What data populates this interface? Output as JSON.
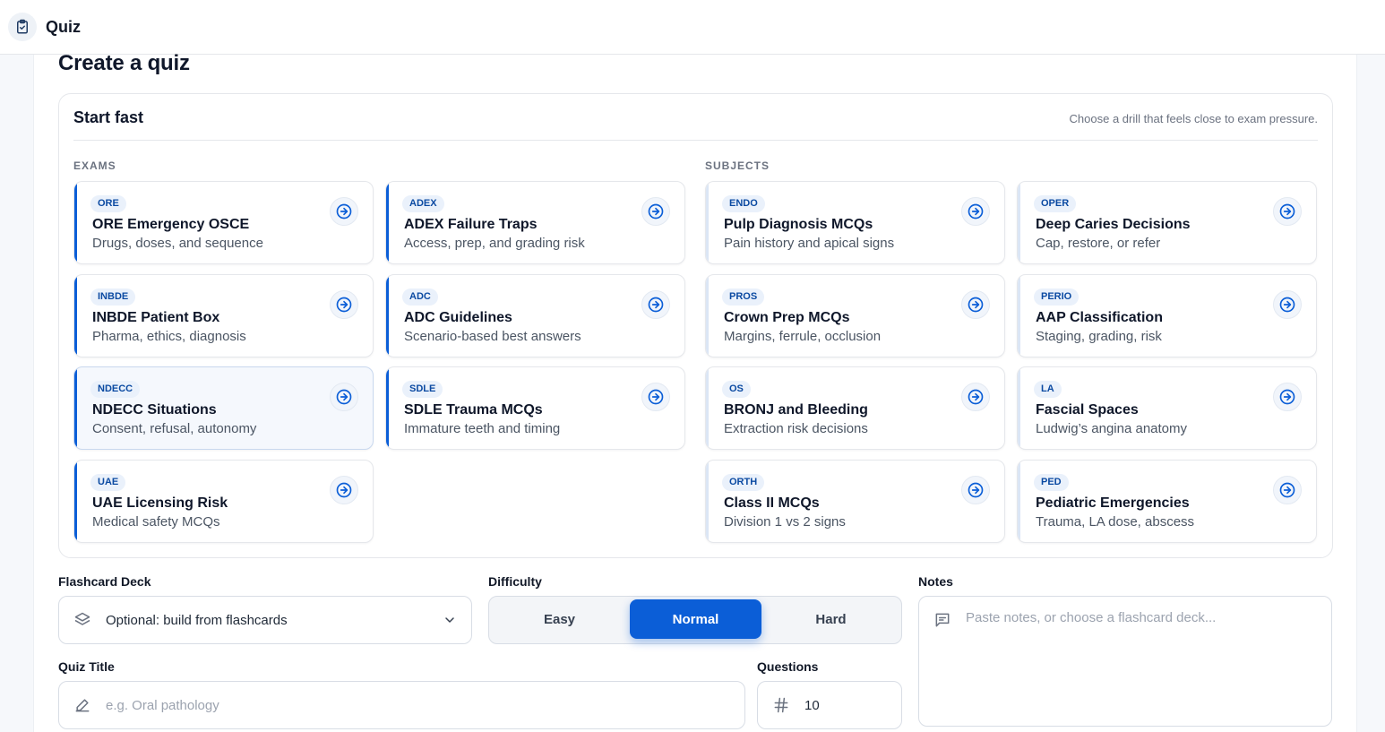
{
  "header": {
    "app_title": "Quiz",
    "icon": "clipboard-check-icon"
  },
  "page": {
    "title": "Create a quiz"
  },
  "start_fast": {
    "title": "Start fast",
    "hint": "Choose a drill that feels close to exam pressure.",
    "exams_label": "EXAMS",
    "subjects_label": "SUBJECTS",
    "exams": [
      {
        "tag": "ORE",
        "title": "ORE Emergency OSCE",
        "subtitle": "Drugs, doses, and sequence"
      },
      {
        "tag": "ADEX",
        "title": "ADEX Failure Traps",
        "subtitle": "Access, prep, and grading risk"
      },
      {
        "tag": "INBDE",
        "title": "INBDE Patient Box",
        "subtitle": "Pharma, ethics, diagnosis"
      },
      {
        "tag": "ADC",
        "title": "ADC Guidelines",
        "subtitle": "Scenario-based best answers"
      },
      {
        "tag": "NDECC",
        "title": "NDECC Situations",
        "subtitle": "Consent, refusal, autonomy"
      },
      {
        "tag": "SDLE",
        "title": "SDLE Trauma MCQs",
        "subtitle": "Immature teeth and timing"
      },
      {
        "tag": "UAE",
        "title": "UAE Licensing Risk",
        "subtitle": "Medical safety MCQs"
      }
    ],
    "subjects": [
      {
        "tag": "ENDO",
        "title": "Pulp Diagnosis MCQs",
        "subtitle": "Pain history and apical signs"
      },
      {
        "tag": "OPER",
        "title": "Deep Caries Decisions",
        "subtitle": "Cap, restore, or refer"
      },
      {
        "tag": "PROS",
        "title": "Crown Prep MCQs",
        "subtitle": "Margins, ferrule, occlusion"
      },
      {
        "tag": "PERIO",
        "title": "AAP Classification",
        "subtitle": "Staging, grading, risk"
      },
      {
        "tag": "OS",
        "title": "BRONJ and Bleeding",
        "subtitle": "Extraction risk decisions"
      },
      {
        "tag": "LA",
        "title": "Fascial Spaces",
        "subtitle": "Ludwig’s angina anatomy"
      },
      {
        "tag": "ORTH",
        "title": "Class II MCQs",
        "subtitle": "Division 1 vs 2 signs"
      },
      {
        "tag": "PED",
        "title": "Pediatric Emergencies",
        "subtitle": "Trauma, LA dose, abscess"
      }
    ]
  },
  "form": {
    "deck_label": "Flashcard Deck",
    "deck_value": "Optional: build from flashcards",
    "difficulty_label": "Difficulty",
    "difficulty_options": [
      "Easy",
      "Normal",
      "Hard"
    ],
    "difficulty_selected": "Normal",
    "notes_label": "Notes",
    "notes_placeholder": "Paste notes, or choose a flashcard deck...",
    "title_label": "Quiz Title",
    "title_placeholder": "e.g. Oral pathology",
    "questions_label": "Questions",
    "questions_value": "10"
  },
  "colors": {
    "accent": "#0b5ed7",
    "tag_bg": "#eaf1fb",
    "tag_text": "#0b4aa2"
  }
}
